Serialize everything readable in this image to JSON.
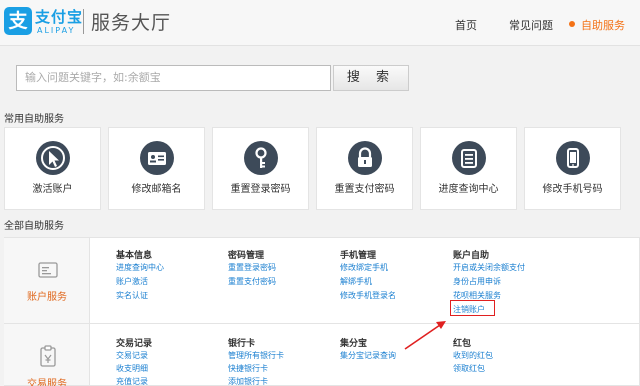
{
  "header": {
    "logo_mark": "支",
    "logo_cn": "支付宝",
    "logo_en": "ALIPAY",
    "title": "服务大厅",
    "nav": [
      {
        "label": "首页"
      },
      {
        "label": "常见问题"
      },
      {
        "label": "自助服务"
      }
    ]
  },
  "search": {
    "placeholder": "输入问题关键字，如:余额宝",
    "button": "搜 索"
  },
  "common": {
    "title": "常用自助服务",
    "tiles": [
      {
        "label": "激活账户",
        "icon": "cursor-icon"
      },
      {
        "label": "修改邮箱名",
        "icon": "id-card-icon"
      },
      {
        "label": "重置登录密码",
        "icon": "key-icon"
      },
      {
        "label": "重置支付密码",
        "icon": "lock-icon"
      },
      {
        "label": "进度查询中心",
        "icon": "document-icon"
      },
      {
        "label": "修改手机号码",
        "icon": "phone-icon"
      }
    ]
  },
  "all": {
    "title": "全部自助服务",
    "rows": [
      {
        "label": "账户服务",
        "icon": "account-card-icon",
        "columns": [
          {
            "heading": "基本信息",
            "links": [
              "进度查询中心",
              "账户激活",
              "实名认证"
            ]
          },
          {
            "heading": "密码管理",
            "links": [
              "重置登录密码",
              "重置支付密码"
            ]
          },
          {
            "heading": "手机管理",
            "links": [
              "修改绑定手机",
              "解绑手机",
              "修改手机登录名"
            ]
          },
          {
            "heading": "账户自助",
            "links": [
              "开启或关闭余额支付",
              "身份占用申诉",
              "花呗相关服务",
              "注销账户"
            ]
          }
        ]
      },
      {
        "label": "交易服务",
        "icon": "clipboard-icon",
        "columns": [
          {
            "heading": "交易记录",
            "links": [
              "交易记录",
              "收支明细",
              "充值记录"
            ]
          },
          {
            "heading": "银行卡",
            "links": [
              "管理所有银行卡",
              "快捷银行卡",
              "添加银行卡"
            ]
          },
          {
            "heading": "集分宝",
            "links": [
              "集分宝记录查询"
            ]
          },
          {
            "heading": "红包",
            "links": [
              "收到的红包",
              "领取红包"
            ]
          }
        ]
      }
    ]
  },
  "colors": {
    "brand": "#1a9fe4",
    "accent": "#f47216",
    "link": "#1a7fd0",
    "highlight": "#e02020"
  }
}
